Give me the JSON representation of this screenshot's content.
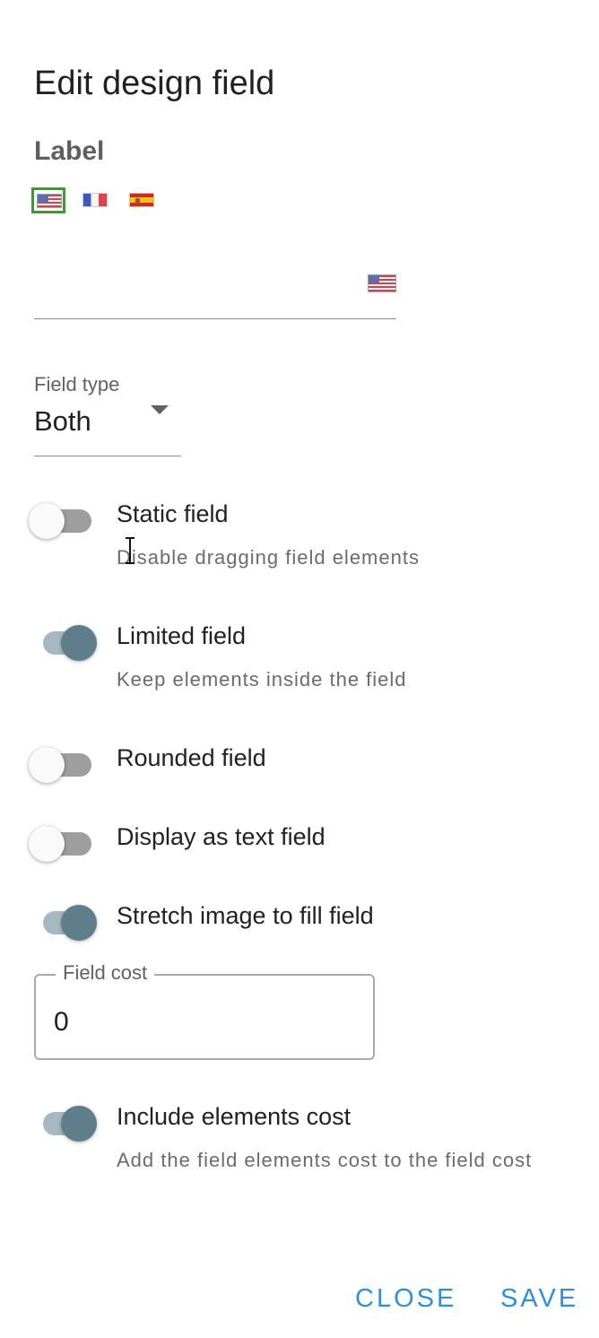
{
  "dialog": {
    "title": "Edit design field"
  },
  "label_section": {
    "heading": "Label",
    "languages": [
      {
        "code": "us",
        "icon": "us-flag-icon",
        "selected": true
      },
      {
        "code": "fr",
        "icon": "fr-flag-icon",
        "selected": false
      },
      {
        "code": "es",
        "icon": "es-flag-icon",
        "selected": false
      }
    ],
    "input": {
      "value": "",
      "placeholder": ""
    }
  },
  "field_type": {
    "caption": "Field type",
    "value": "Both"
  },
  "switches": [
    {
      "id": "static",
      "label": "Static field",
      "helper": "Disable dragging field elements",
      "checked": false
    },
    {
      "id": "limited",
      "label": "Limited field",
      "helper": "Keep elements inside the field",
      "checked": true
    },
    {
      "id": "rounded",
      "label": "Rounded field",
      "helper": "",
      "checked": false
    },
    {
      "id": "text",
      "label": "Display as text field",
      "helper": "",
      "checked": false
    },
    {
      "id": "stretch",
      "label": "Stretch image to fill field",
      "helper": "",
      "checked": true
    },
    {
      "id": "include-cost",
      "label": "Include elements cost",
      "helper": "Add the field elements cost to the field cost",
      "checked": true
    }
  ],
  "field_cost": {
    "legend": "Field cost",
    "value": "0"
  },
  "actions": {
    "close_label": "CLOSE",
    "save_label": "SAVE"
  },
  "colors": {
    "accent": "#2f8fdc",
    "switch_on": "#607d8b",
    "selected_flag_border": "#3a9d2a"
  }
}
